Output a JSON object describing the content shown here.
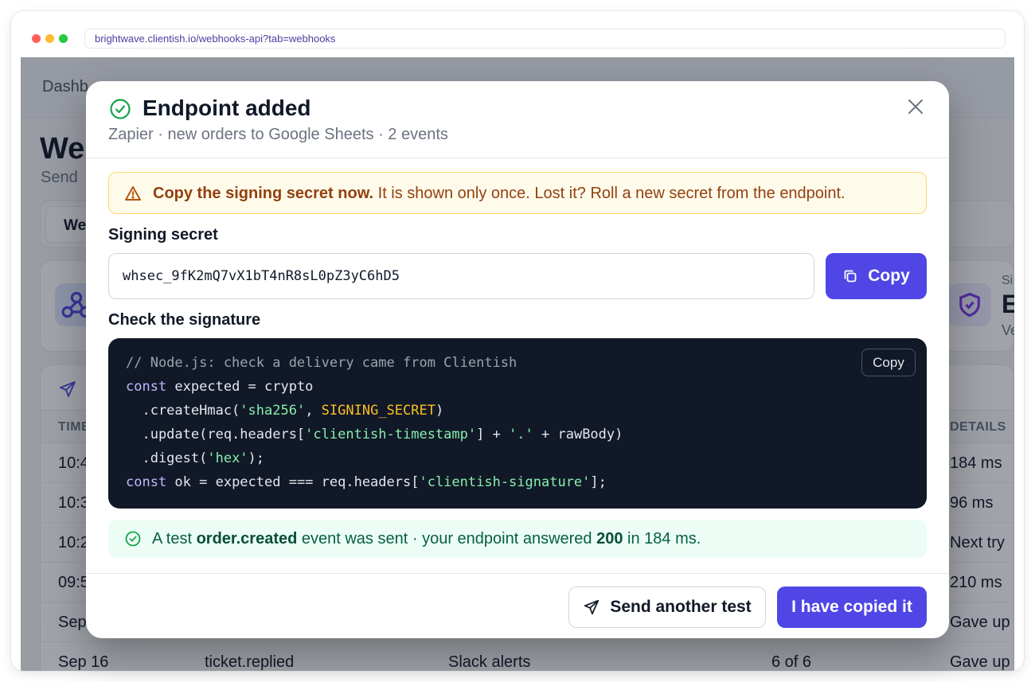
{
  "browser": {
    "url": "brightwave.clientish.io/webhooks-api?tab=webhooks"
  },
  "background": {
    "breadcrumb": "Dashb",
    "page_title": "We",
    "page_subtitle": "Send",
    "tab_label": "We",
    "card2_title": "Si",
    "card2_value": "E",
    "card2_sub": "Ve",
    "table": {
      "headers": [
        "TIME",
        "DETAILS"
      ],
      "rows": [
        [
          "10:4",
          "184 ms"
        ],
        [
          "10:3",
          "96 ms"
        ],
        [
          "10:2",
          "Next try"
        ],
        [
          "09:5",
          "210 ms"
        ],
        [
          "Sep",
          "Gave up"
        ],
        [
          "Sep 16",
          "Gave up"
        ]
      ],
      "partial_row": [
        "Sep 16",
        "ticket.replied",
        "Slack alerts",
        "6 of 6"
      ]
    }
  },
  "modal": {
    "title": "Endpoint added",
    "subtitle": "Zapier · new orders to Google Sheets · 2 events",
    "warning": {
      "bold": "Copy the signing secret now.",
      "text": " It is shown only once. Lost it? Roll a new secret from the endpoint."
    },
    "secret": {
      "label": "Signing secret",
      "value": "whsec_9fK2mQ7vX1bT4nR8sL0pZ3yC6hD5",
      "copy_label": "Copy"
    },
    "signature": {
      "label": "Check the signature",
      "copy_label": "Copy",
      "code": {
        "l1": "// Node.js: check a delivery came from Clientish",
        "l2_kw": "const",
        "l2_rest": " expected = crypto",
        "l3_a": "  .createHmac(",
        "l3_str": "'sha256'",
        "l3_b": ", ",
        "l3_const": "SIGNING_SECRET",
        "l3_c": ")",
        "l4_a": "  .update(req.headers[",
        "l4_str": "'clientish-timestamp'",
        "l4_b": "] + ",
        "l4_str2": "'.'",
        "l4_c": " + rawBody)",
        "l5_a": "  .digest(",
        "l5_str": "'hex'",
        "l5_b": ");",
        "l6_kw": "const",
        "l6_a": " ok = expected === req.headers[",
        "l6_str": "'clientish-signature'",
        "l6_b": "];"
      }
    },
    "success": {
      "t1": "A test ",
      "b1": "order.created",
      "t2": " event was sent · your endpoint answered ",
      "b2": "200",
      "t3": " in 184 ms."
    },
    "footer": {
      "secondary_label": "Send another test",
      "primary_label": "I have copied it"
    }
  },
  "colors": {
    "accent": "#4f46e5",
    "success": "#16a34a",
    "warning": "#b45309",
    "code_bg": "#111827"
  }
}
